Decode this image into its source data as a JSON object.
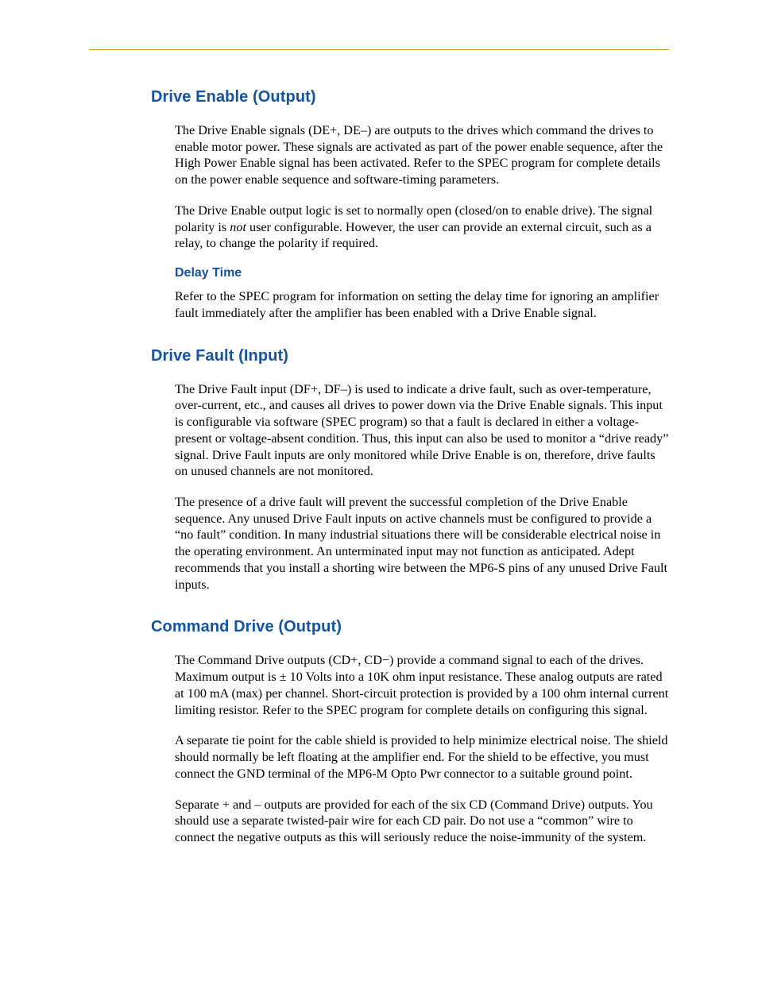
{
  "sections": {
    "driveEnable": {
      "heading": "Drive Enable (Output)",
      "p1": "The Drive Enable signals (DE+, DE–) are outputs to the drives which command the drives to enable motor power. These signals are activated as part of the power enable sequence, after the High Power Enable signal has been activated. Refer to the SPEC program for complete details on the power enable sequence and software-timing parameters.",
      "p2a": "The Drive Enable output logic is set to normally open (closed/on to enable drive). The signal polarity is ",
      "p2i": "not",
      "p2b": " user configurable. However, the user can provide an external circuit, such as a relay, to change the polarity if required.",
      "delay": {
        "heading": "Delay Time",
        "p1": "Refer to the SPEC program for information on setting the delay time for ignoring an amplifier fault immediately after the amplifier has been enabled with a Drive Enable signal."
      }
    },
    "driveFault": {
      "heading": "Drive Fault (Input)",
      "p1": "The Drive Fault input (DF+, DF–) is used to indicate a drive fault, such as over-temperature, over-current, etc., and causes all drives to power down via the Drive Enable signals. This input is configurable via software (SPEC program) so that a fault is declared in either a voltage-present or voltage-absent condition. Thus, this input can also be used to monitor a “drive ready” signal. Drive Fault inputs are only monitored while Drive Enable is on, therefore, drive faults on unused channels are not monitored.",
      "p2": "The presence of a drive fault will prevent the successful completion of the Drive Enable sequence. Any unused Drive Fault inputs on active channels must be configured to provide a “no fault” condition. In many industrial situations there will be considerable electrical noise in the operating environment. An unterminated input may not function as anticipated. Adept recommends that you install a shorting wire between the MP6-S pins of any unused Drive Fault inputs."
    },
    "commandDrive": {
      "heading": "Command Drive (Output)",
      "p1": "The Command Drive outputs (CD+, CD−) provide a command signal to each of the drives. Maximum output is ± 10 Volts into a 10K ohm input resistance. These analog outputs are rated at 100 mA (max) per channel. Short-circuit protection is provided by a 100 ohm internal current limiting resistor. Refer to the SPEC program for complete details on configuring this signal.",
      "p2": "A separate tie point for the cable shield is provided to help minimize electrical noise. The shield should normally be left floating at the amplifier end. For the shield to be effective, you must connect the GND terminal of the MP6-M Opto Pwr connector to a suitable ground point.",
      "p3": "Separate + and – outputs are provided for each of the six CD (Command Drive) outputs. You should use a separate twisted-pair wire for each CD pair. Do not use a “common” wire to connect the negative outputs as this will seriously reduce the noise-immunity of the system."
    }
  }
}
